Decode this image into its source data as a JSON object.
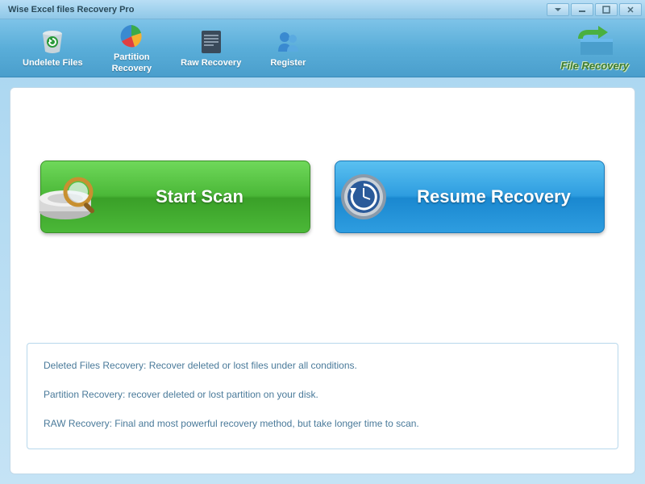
{
  "titlebar": {
    "text": "Wise Excel files Recovery Pro"
  },
  "toolbar": {
    "undelete": "Undelete Files",
    "partition": "Partition\nRecovery",
    "raw": "Raw Recovery",
    "register": "Register",
    "fileRecovery": "File Recovery"
  },
  "actions": {
    "startScan": "Start  Scan",
    "resumeRecovery": "Resume Recovery"
  },
  "info": {
    "line1": "Deleted Files Recovery: Recover deleted or lost files  under all conditions.",
    "line2": "Partition Recovery: recover deleted or lost partition on your disk.",
    "line3": "RAW Recovery: Final and most powerful recovery method, but take longer time to scan."
  }
}
